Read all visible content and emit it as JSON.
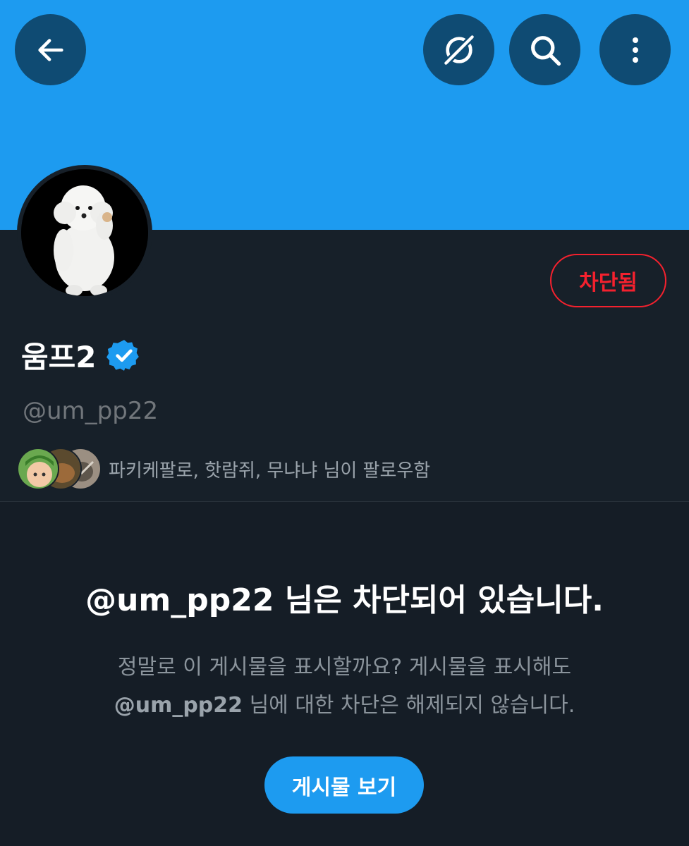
{
  "header": {
    "back_icon": "arrow-left-icon",
    "grok_icon": "grok-icon",
    "search_icon": "search-icon",
    "more_icon": "more-vertical-icon",
    "banner_color": "#1d9bf0"
  },
  "profile": {
    "display_name": "움프2",
    "verified_icon": "verified-badge-icon",
    "handle": "@um_pp22",
    "blocked_label": "차단됨",
    "followers_text": "파키케팔로, 핫람쥐, 무냐냐 님이 팔로우함"
  },
  "blocked_notice": {
    "title": "@um_pp22 님은 차단되어 있습니다.",
    "desc_line1": "정말로 이 게시물을 표시할까요? 게시물을 표시해도",
    "desc_handle": "@um_pp22",
    "desc_line2_rest": " 님에 대한 차단은 해제되지 않습니다.",
    "view_button": "게시물 보기"
  },
  "colors": {
    "accent": "#1d9bf0",
    "danger": "#f4212e",
    "background": "#151d26"
  }
}
